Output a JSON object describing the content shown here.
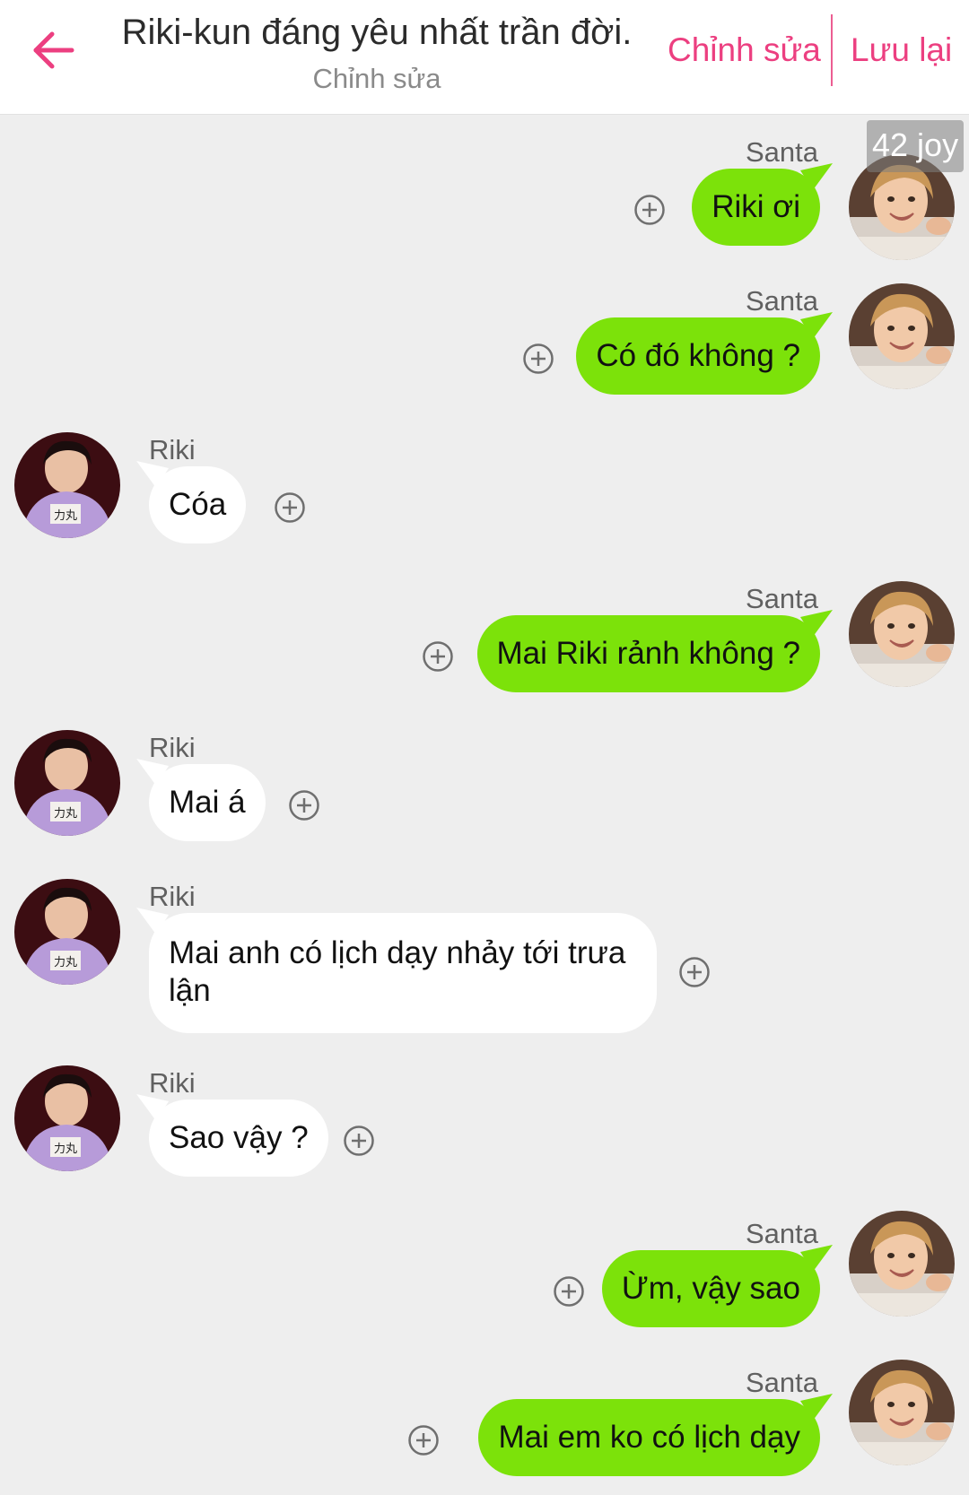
{
  "header": {
    "title": "Riki-kun đáng yêu nhất trần đời.",
    "subtitle": "Chỉnh sửa",
    "edit_label": "Chỉnh sửa",
    "save_label": "Lưu lại"
  },
  "counter": "42 joy",
  "colors": {
    "accent": "#ec3f80",
    "bubble_right": "#7ce20a",
    "bubble_left": "#ffffff",
    "background": "#eeeeee"
  },
  "messages": [
    {
      "sender": "Santa",
      "text": "Riki ơi"
    },
    {
      "sender": "Santa",
      "text": "Có đó không ?"
    },
    {
      "sender": "Riki",
      "text": "Cóa"
    },
    {
      "sender": "Santa",
      "text": "Mai Riki rảnh không ?"
    },
    {
      "sender": "Riki",
      "text": "Mai á"
    },
    {
      "sender": "Riki",
      "text": "Mai anh có lịch dạy nhảy tới trưa",
      "text2": "lận"
    },
    {
      "sender": "Riki",
      "text": "Sao vậy ?"
    },
    {
      "sender": "Santa",
      "text": "Ừm, vậy sao"
    },
    {
      "sender": "Santa",
      "text": "Mai em ko có lịch dạy"
    }
  ]
}
